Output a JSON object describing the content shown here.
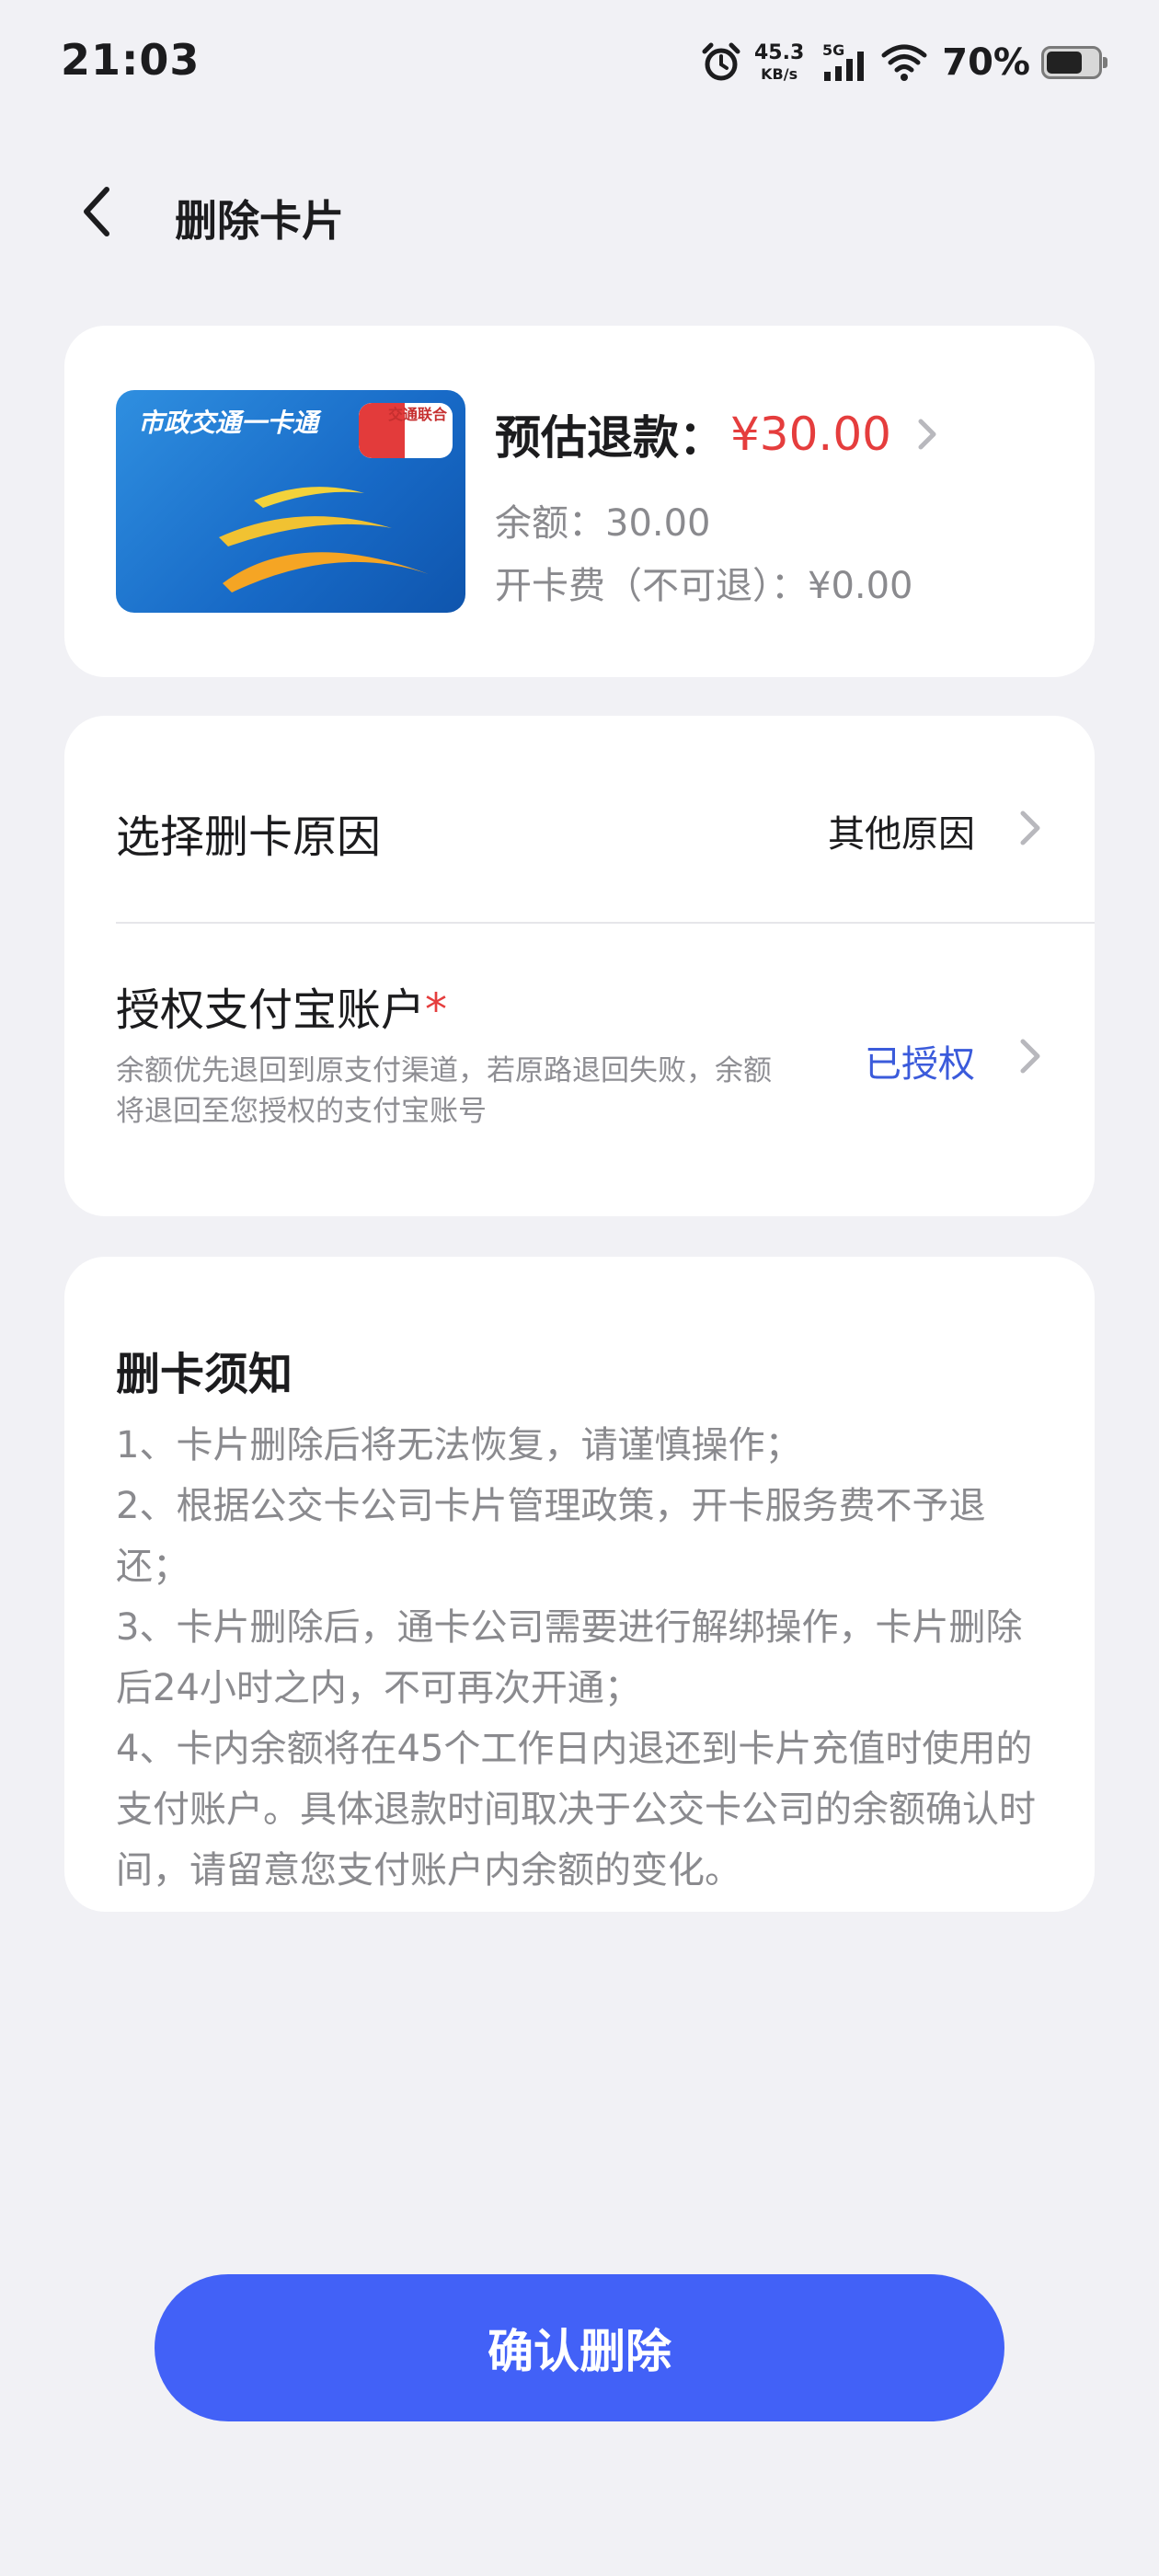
{
  "status_bar": {
    "time": "21:03",
    "net_speed_value": "45.3",
    "net_speed_unit": "KB/s",
    "network": "5G",
    "battery": "70%"
  },
  "nav": {
    "title": "删除卡片"
  },
  "card_summary": {
    "card_brand": "市政交通一卡通",
    "card_badge": "交通联合",
    "refund_label": "预估退款：",
    "refund_amount": "¥30.00",
    "balance": "余额：30.00",
    "fee": "开卡费（不可退）：¥0.00"
  },
  "options": {
    "reason_label": "选择删卡原因",
    "reason_value": "其他原因",
    "auth_label": "授权支付宝账户",
    "auth_required_mark": "*",
    "auth_desc": "余额优先退回到原支付渠道，若原路退回失败，余额将退回至您授权的支付宝账号",
    "auth_value": "已授权"
  },
  "notice": {
    "title": "删卡须知",
    "items": [
      "1、卡片删除后将无法恢复，请谨慎操作；",
      "2、根据公交卡公司卡片管理政策，开卡服务费不予退还；",
      "3、卡片删除后，通卡公司需要进行解绑操作，卡片删除后24小时之内，不可再次开通；",
      "4、卡内余额将在45个工作日内退还到卡片充值时使用的支付账户。具体退款时间取决于公交卡公司的余额确认时间，请留意您支付账户内余额的变化。"
    ]
  },
  "confirm_button": "确认删除",
  "colors": {
    "accent": "#4261f7",
    "refund_red": "#e53d3d",
    "authorized_blue": "#3b5bdb"
  }
}
